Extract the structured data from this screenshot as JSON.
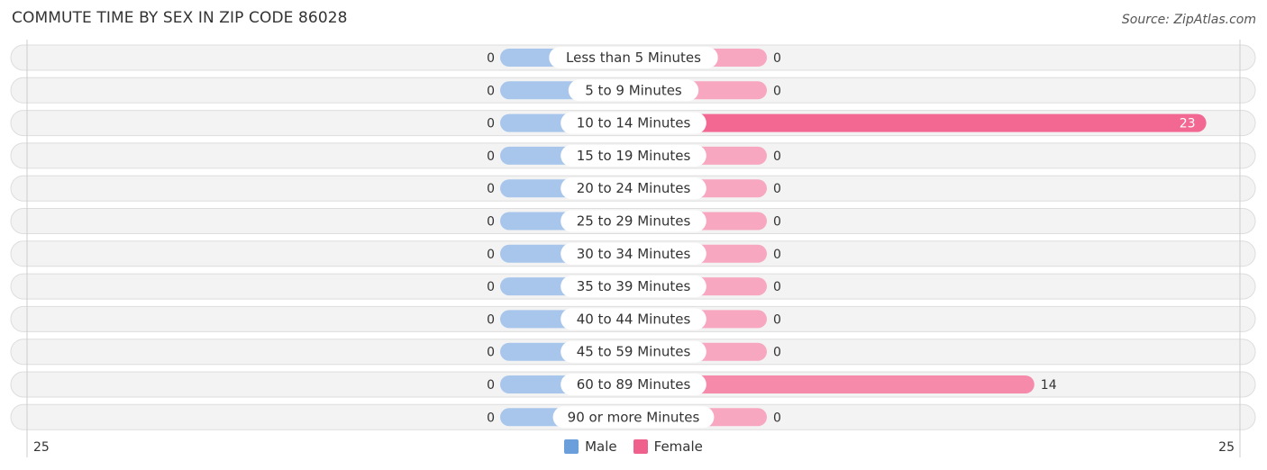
{
  "title": "COMMUTE TIME BY SEX IN ZIP CODE 86028",
  "source": "Source: ZipAtlas.com",
  "colors": {
    "male": "#a8c6ec",
    "male_legend": "#6a9fdc",
    "female_light": "#f7a8c0",
    "female_strong": "#f26892",
    "female_mid": "#f58aab",
    "female_legend": "#f0608d",
    "row_bg": "#f3f3f3",
    "row_border": "#dddddd"
  },
  "chart_data": {
    "type": "bar",
    "orientation": "horizontal-butterfly",
    "title": "COMMUTE TIME BY SEX IN ZIP CODE 86028",
    "categories": [
      "Less than 5 Minutes",
      "5 to 9 Minutes",
      "10 to 14 Minutes",
      "15 to 19 Minutes",
      "20 to 24 Minutes",
      "25 to 29 Minutes",
      "30 to 34 Minutes",
      "35 to 39 Minutes",
      "40 to 44 Minutes",
      "45 to 59 Minutes",
      "60 to 89 Minutes",
      "90 or more Minutes"
    ],
    "series": [
      {
        "name": "Male",
        "values": [
          0,
          0,
          0,
          0,
          0,
          0,
          0,
          0,
          0,
          0,
          0,
          0
        ]
      },
      {
        "name": "Female",
        "values": [
          0,
          0,
          23,
          0,
          0,
          0,
          0,
          0,
          0,
          0,
          14,
          0
        ]
      }
    ],
    "xlim": [
      25,
      25
    ],
    "axis_left_label": "25",
    "axis_right_label": "25",
    "legend": [
      "Male",
      "Female"
    ],
    "legend_position": "bottom-center",
    "grid": false
  }
}
